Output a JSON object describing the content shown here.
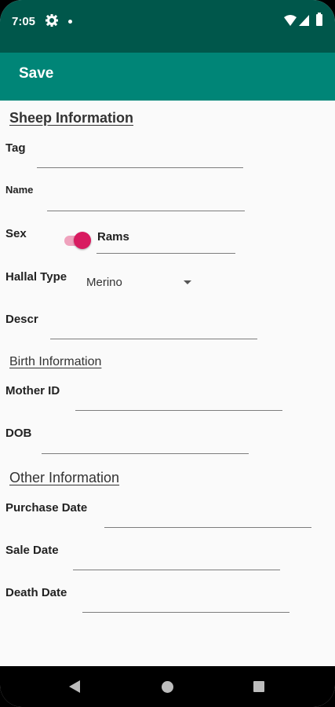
{
  "status_bar": {
    "time": "7:05",
    "icons": [
      "gear-icon",
      "notification-dot-icon",
      "wifi-icon",
      "cell-signal-icon",
      "battery-icon"
    ]
  },
  "toolbar": {
    "save_label": "Save"
  },
  "colors": {
    "status_bar": "#00574b",
    "app_bar": "#008577",
    "accent": "#d81b60",
    "background": "#fafafa"
  },
  "sections": {
    "sheep": "Sheep Information",
    "birth": "Birth Information",
    "other": "Other Information"
  },
  "fields": {
    "tag": {
      "label": "Tag",
      "value": ""
    },
    "name": {
      "label": "Name",
      "value": ""
    },
    "sex": {
      "label": "Sex",
      "switch_label": "Rams",
      "checked": true
    },
    "hallal_type": {
      "label": "Hallal Type",
      "selected": "Merino"
    },
    "descr": {
      "label": "Descr",
      "value": ""
    },
    "mother_id": {
      "label": "Mother ID",
      "value": ""
    },
    "dob": {
      "label": "DOB",
      "value": ""
    },
    "purchase_date": {
      "label": "Purchase Date",
      "value": ""
    },
    "sale_date": {
      "label": "Sale Date",
      "value": ""
    },
    "death_date": {
      "label": "Death Date",
      "value": ""
    }
  },
  "nav_bar": {
    "icons": [
      "back-icon",
      "home-icon",
      "recents-icon"
    ]
  }
}
